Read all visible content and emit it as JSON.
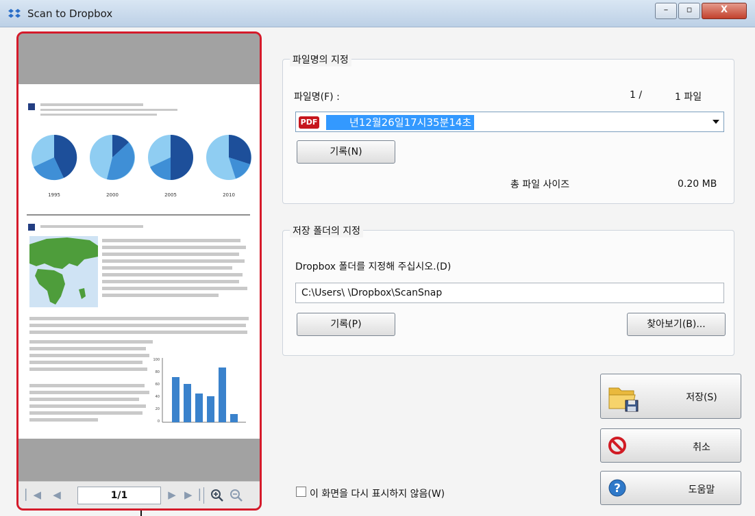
{
  "window": {
    "title": "Scan to Dropbox",
    "btn_min": "–",
    "btn_max": "▫",
    "btn_close": "X"
  },
  "preview": {
    "page_indicator": "1/1",
    "year_labels": [
      "1995",
      "2000",
      "2005",
      "2010"
    ],
    "bar_axis_labels": [
      "100",
      "80",
      "60",
      "40",
      "20",
      "0"
    ],
    "nav": [
      "first-page-icon",
      "prev-page-icon",
      "next-page-icon",
      "last-page-icon",
      "zoom-in-icon",
      "zoom-out-icon"
    ]
  },
  "filename_group": {
    "title": "파일명의 지정",
    "label": "파일명(F) :",
    "label_hotkey": "F",
    "count_current": "1 /",
    "count_total": "1 파일",
    "filename_value": "년12월26일17시35분14초",
    "pdf_badge": "PDF",
    "record_button": "기록(N)",
    "total_size_label": "총 파일 사이즈",
    "total_size_value": "0.20 MB"
  },
  "folder_group": {
    "title": "저장 폴더의 지정",
    "label": "Dropbox 폴더를 지정해 주십시오.(D)",
    "path_value": "C:\\Users\\        \\Dropbox\\ScanSnap",
    "record_button": "기록(P)",
    "browse_button": "찾아보기(B)..."
  },
  "actions": {
    "save": "저장(S)",
    "cancel": "취소",
    "help": "도움말"
  },
  "dont_show": "이 화면을 다시 표시하지 않음(W)",
  "colors": {
    "highlight": "#d51a2a",
    "selection": "#3399ff",
    "pie_dark": "#1d4f9a",
    "pie_mid": "#3f8fd6",
    "pie_light": "#8fcdf2",
    "bar": "#3a82cc",
    "map_land": "#4e9d3b",
    "map_sea": "#cfe3f4"
  }
}
